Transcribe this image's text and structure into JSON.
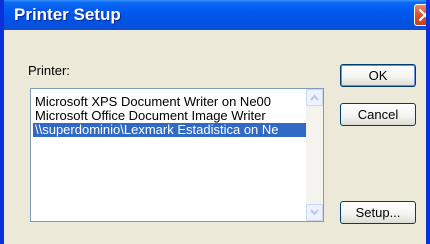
{
  "window": {
    "title": "Printer Setup"
  },
  "printer_label": "Printer:",
  "printers": [
    "Microsoft XPS Document Writer on Ne00",
    "Microsoft Office Document Image Writer",
    "\\\\superdominio\\Lexmark Estadistica on Ne"
  ],
  "selected_printer": "\\\\superdominio\\Lexmark Estadistica on Ne",
  "buttons": {
    "ok": "OK",
    "cancel": "Cancel",
    "setup": "Setup..."
  },
  "colors": {
    "titlebar": "#0058ee",
    "selection": "#316ac5",
    "window_bg": "#ece9d8",
    "close_button": "#d7532f"
  }
}
